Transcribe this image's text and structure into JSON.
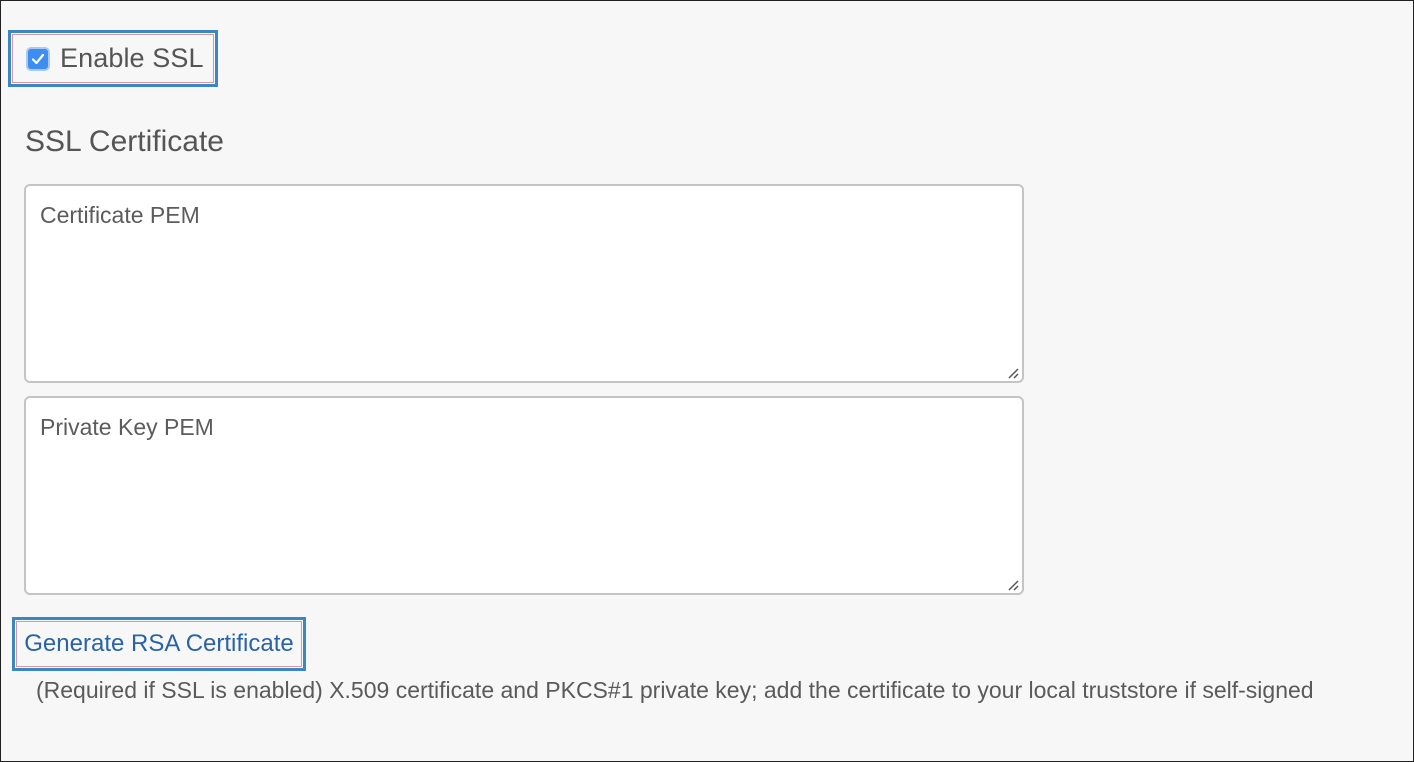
{
  "ssl": {
    "enable_label": "Enable SSL",
    "enabled": true
  },
  "certificate": {
    "section_title": "SSL Certificate",
    "cert_placeholder": "Certificate PEM",
    "key_placeholder": "Private Key PEM",
    "cert_value": "",
    "key_value": "",
    "generate_label": "Generate RSA Certificate",
    "help_text": "(Required if SSL is enabled) X.509 certificate and PKCS#1 private key; add the certificate to your local truststore if self-signed"
  },
  "colors": {
    "accent": "#3d8ef0",
    "link": "#2a63a5",
    "highlight_border": "#3b87c4",
    "text": "#555555",
    "background": "#f7f7f7"
  },
  "icons": {
    "checkbox": "checkmark-icon",
    "resize": "resize-grip-icon"
  }
}
